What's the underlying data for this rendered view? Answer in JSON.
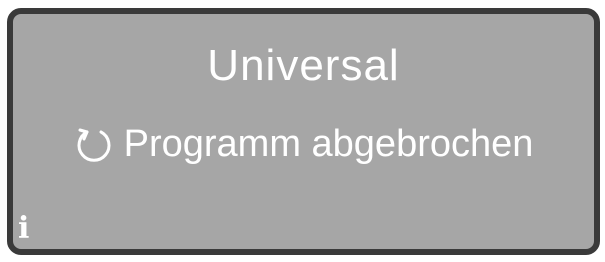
{
  "display": {
    "program_name": "Universal",
    "status_message": "Programm abgebrochen",
    "status_icon": "restart-icon",
    "info_icon": "info-icon",
    "info_glyph": "i",
    "colors": {
      "screen_background": "#a6a6a6",
      "screen_border": "#3a3a3a",
      "text": "#ffffff"
    }
  }
}
